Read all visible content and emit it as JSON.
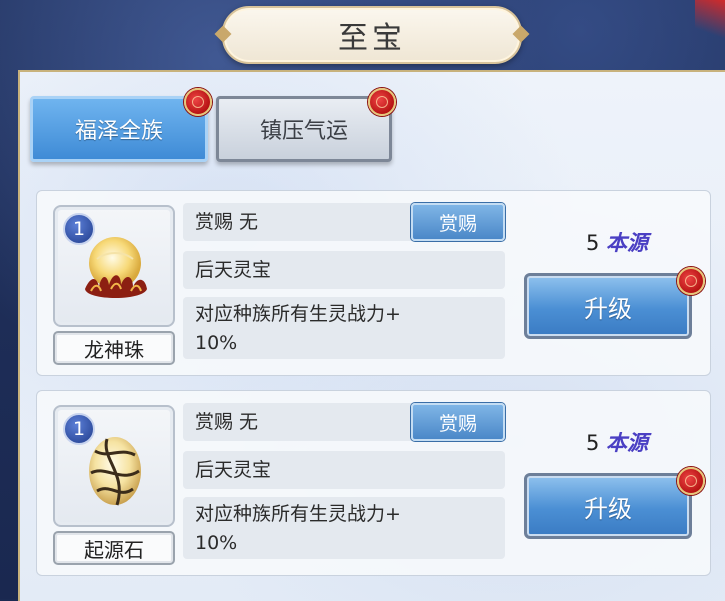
{
  "header": {
    "title": "至宝"
  },
  "tabs": [
    {
      "label": "福泽全族",
      "active": true,
      "badge": true
    },
    {
      "label": "镇压气运",
      "active": false,
      "badge": true
    }
  ],
  "items": [
    {
      "level": "1",
      "name": "龙神珠",
      "icon": "dragon-pearl-icon",
      "reward_text": "赏赐 无",
      "reward_button": "赏赐",
      "type": "后天灵宝",
      "effect_line1": "对应种族所有生灵战力+",
      "effect_line2": "10%",
      "cost_amount": "5",
      "cost_label": "本源",
      "upgrade_label": "升级",
      "upgrade_badge": true
    },
    {
      "level": "1",
      "name": "起源石",
      "icon": "origin-stone-icon",
      "reward_text": "赏赐 无",
      "reward_button": "赏赐",
      "type": "后天灵宝",
      "effect_line1": "对应种族所有生灵战力+",
      "effect_line2": "10%",
      "cost_amount": "5",
      "cost_label": "本源",
      "upgrade_label": "升级",
      "upgrade_badge": true
    }
  ],
  "colors": {
    "tab_active": "#4f9ae0",
    "cost_label": "#4a3fc3",
    "badge_red": "#c81e1e"
  }
}
